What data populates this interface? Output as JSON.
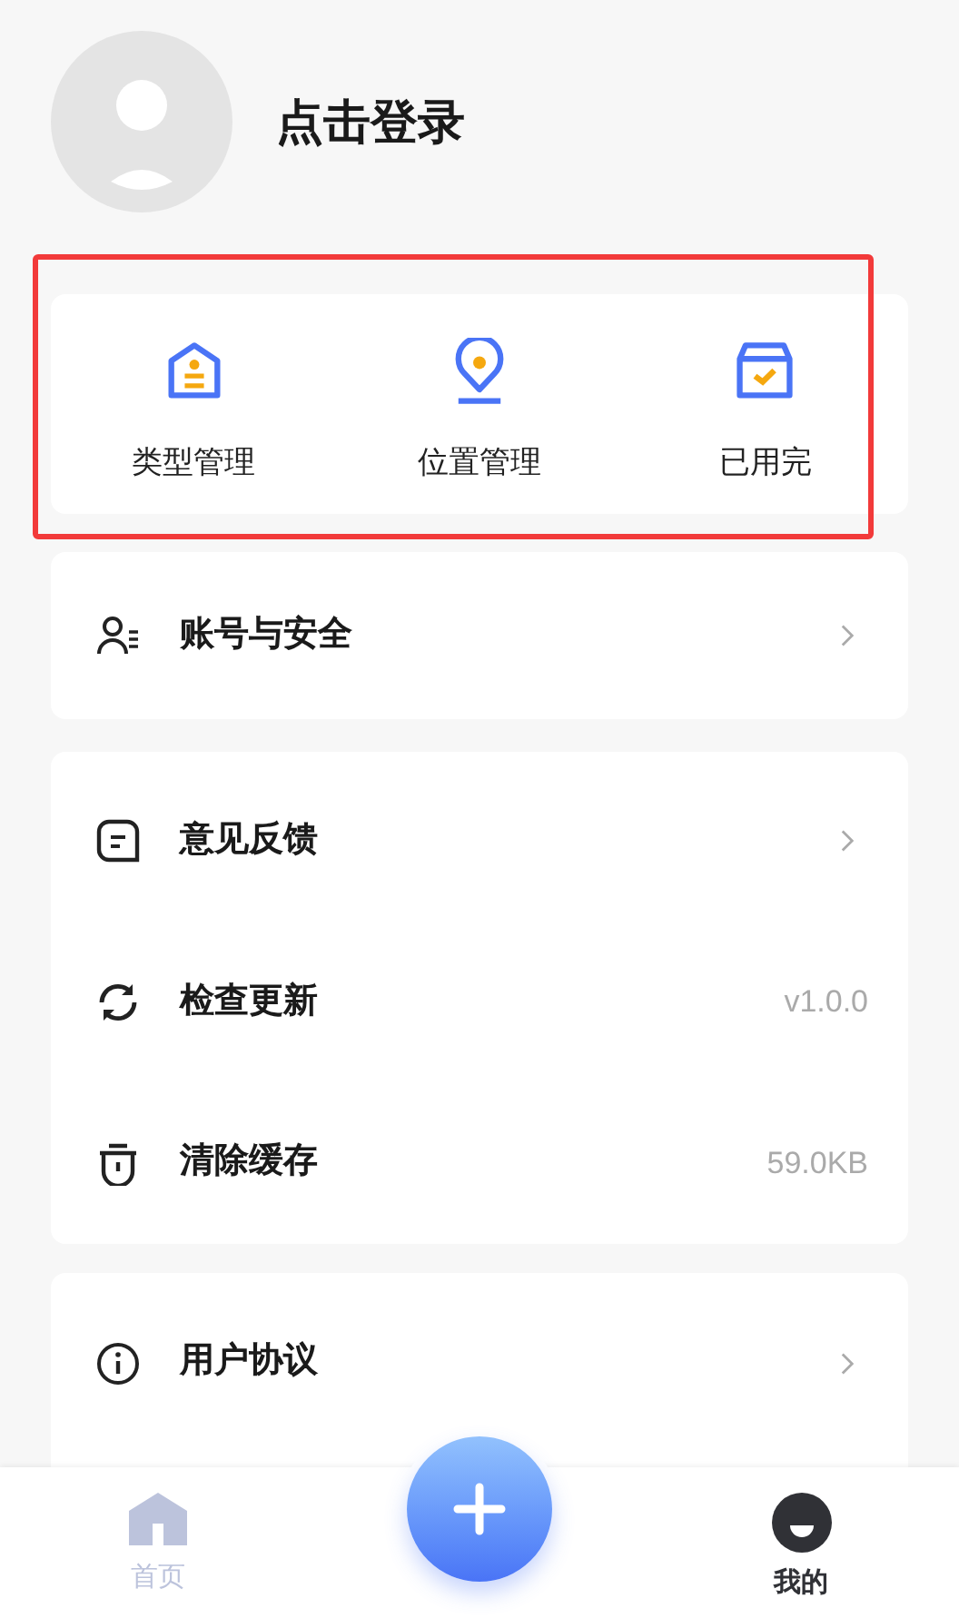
{
  "profile": {
    "title": "点击登录"
  },
  "quick_actions": [
    {
      "label": "类型管理"
    },
    {
      "label": "位置管理"
    },
    {
      "label": "已用完"
    }
  ],
  "menu_groups": [
    {
      "items": [
        {
          "label": "账号与安全",
          "kind": "arrow"
        }
      ]
    },
    {
      "items": [
        {
          "label": "意见反馈",
          "kind": "arrow"
        },
        {
          "label": "检查更新",
          "kind": "value",
          "value": "v1.0.0"
        },
        {
          "label": "清除缓存",
          "kind": "value",
          "value": "59.0KB"
        }
      ]
    },
    {
      "items": [
        {
          "label": "用户协议",
          "kind": "arrow"
        }
      ]
    }
  ],
  "tab_bar": [
    {
      "label": "首页",
      "selected": false
    },
    {
      "label": "我的",
      "selected": true
    }
  ]
}
